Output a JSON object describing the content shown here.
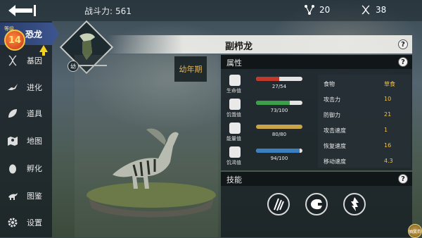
{
  "topbar": {
    "power_label": "战斗力:",
    "power_value": "561",
    "dna_count": "20",
    "gene_count": "38"
  },
  "sidebar": {
    "section_title": "恐龙",
    "level": "14",
    "level_caption": "等级",
    "items": [
      {
        "label": "基因",
        "icon": "dna-icon"
      },
      {
        "label": "进化",
        "icon": "evolution-icon"
      },
      {
        "label": "道具",
        "icon": "leaf-icon"
      },
      {
        "label": "地图",
        "icon": "map-icon"
      },
      {
        "label": "孵化",
        "icon": "egg-icon"
      },
      {
        "label": "图鉴",
        "icon": "dinosaur-icon"
      },
      {
        "label": "设置",
        "icon": "gear-icon"
      }
    ]
  },
  "dino": {
    "name": "副栉龙",
    "stage_tag": "幼",
    "stage_label": "幼年期"
  },
  "attributes": {
    "title": "属性",
    "stats": [
      {
        "name": "生命值",
        "value": "27/54",
        "fraction": 0.5,
        "color": "#c0392b",
        "icon": "heart-icon"
      },
      {
        "name": "饥饿值",
        "value": "73/100",
        "fraction": 0.73,
        "color": "#3ca04a",
        "icon": "meat-icon"
      },
      {
        "name": "能量值",
        "value": "80/80",
        "fraction": 1.0,
        "color": "#c9a44a",
        "icon": "energy-icon"
      },
      {
        "name": "饥渴值",
        "value": "94/100",
        "fraction": 0.94,
        "color": "#3a7fc0",
        "icon": "water-drop-icon"
      }
    ],
    "props": [
      {
        "name": "食物",
        "value": "草食"
      },
      {
        "name": "攻击力",
        "value": "10"
      },
      {
        "name": "防御力",
        "value": "21"
      },
      {
        "name": "攻击速度",
        "value": "1"
      },
      {
        "name": "恢复速度",
        "value": "16"
      },
      {
        "name": "移动速度",
        "value": "4.3"
      }
    ]
  },
  "skills": {
    "title": "技能",
    "items": [
      "claw-slash-icon",
      "roar-icon",
      "charge-icon"
    ]
  },
  "help_symbol": "?",
  "corner_button": "抽奖券",
  "colors": {
    "accent": "#f2c24a",
    "nav_active": "#3d5690"
  }
}
